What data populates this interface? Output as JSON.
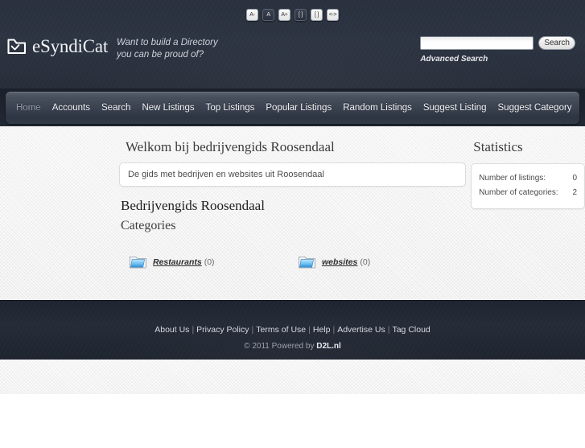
{
  "header": {
    "toolbar_buttons": [
      {
        "name": "font-decrease",
        "label": "A-",
        "active": false
      },
      {
        "name": "font-default",
        "label": "A",
        "active": true
      },
      {
        "name": "font-increase",
        "label": "A+",
        "active": false
      },
      {
        "name": "layout-narrow",
        "label": "[ ]",
        "active": true
      },
      {
        "name": "layout-wide",
        "label": "[ ]",
        "active": false
      },
      {
        "name": "layout-full",
        "label": "<->",
        "active": false
      }
    ],
    "logo_text": "eSyndiCat",
    "logo_icon": "cat-logo-icon",
    "tagline_line1": "Want to build a Directory",
    "tagline_line2": "you can be proud of?",
    "search": {
      "value": "",
      "placeholder": "",
      "button_label": "Search",
      "advanced_label": "Advanced Search"
    }
  },
  "nav": {
    "items": [
      {
        "label": "Home",
        "active": true
      },
      {
        "label": "Accounts",
        "active": false
      },
      {
        "label": "Search",
        "active": false
      },
      {
        "label": "New Listings",
        "active": false
      },
      {
        "label": "Top Listings",
        "active": false
      },
      {
        "label": "Popular Listings",
        "active": false
      },
      {
        "label": "Random Listings",
        "active": false
      },
      {
        "label": "Suggest Listing",
        "active": false
      },
      {
        "label": "Suggest Category",
        "active": false
      }
    ]
  },
  "main": {
    "welcome_title": "Welkom bij bedrijvengids Roosendaal",
    "description": "De gids met bedrijven en websites uit Roosendaal",
    "site_name": "Bedrijvengids Roosendaal",
    "categories_heading": "Categories",
    "categories": [
      {
        "name": "Restaurants",
        "count": "(0)",
        "icon": "folder-icon"
      },
      {
        "name": "websites",
        "count": "(0)",
        "icon": "folder-icon"
      }
    ]
  },
  "sidebar": {
    "statistics_title": "Statistics",
    "stats": [
      {
        "label": "Number of listings:",
        "value": "0"
      },
      {
        "label": "Number of categories:",
        "value": "2"
      }
    ]
  },
  "footer": {
    "links": [
      "About Us",
      "Privacy Policy",
      "Terms of Use",
      "Help",
      "Advertise Us",
      "Tag Cloud"
    ],
    "separator": "|",
    "copyright_prefix": "© 2011 Powered by",
    "copyright_link": "D2L.nl"
  },
  "colors": {
    "header_bg": "#2d3442",
    "nav_bg": "#3a4250",
    "main_bg": "#efefef",
    "footer_bg": "#222936",
    "link": "#d6dae1",
    "folder_blue": "#4aa3e8"
  }
}
